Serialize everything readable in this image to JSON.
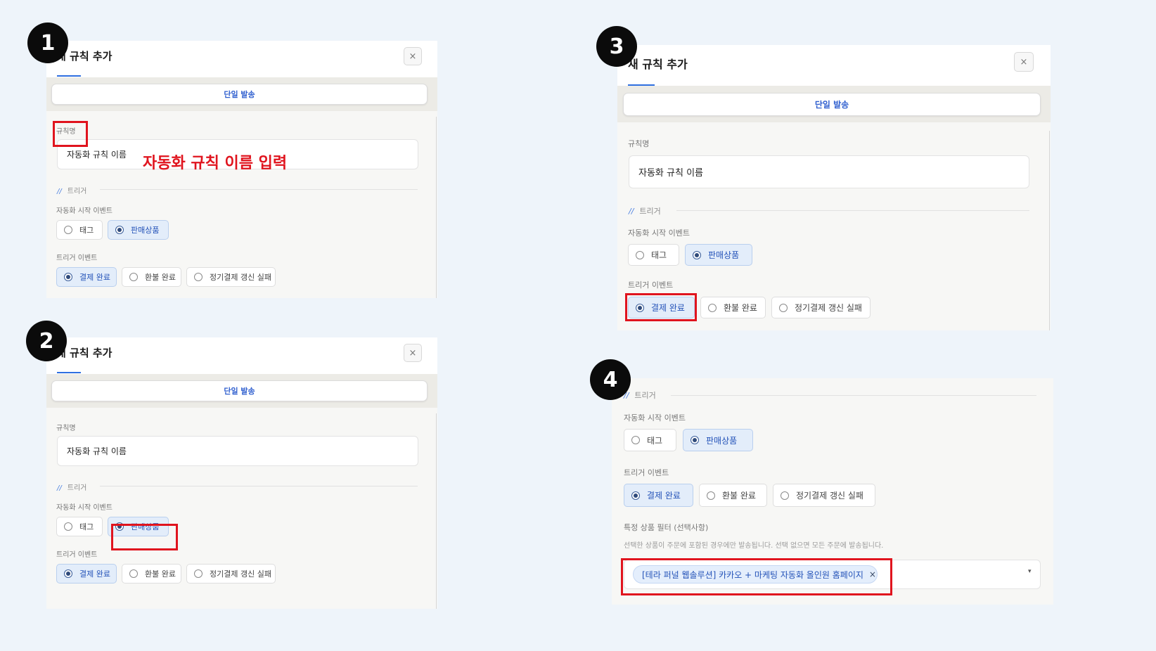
{
  "modal": {
    "title": "새 규칙 추가",
    "title_visible": "새 규칙 추가",
    "close_label": "×",
    "tab_single_send": "단일 발송"
  },
  "form": {
    "rule_name_label": "규칙명",
    "rule_name_value": "자동화 규칙 이름",
    "trigger_section": "트리거",
    "section_marker": "//",
    "start_event_label": "자동화 시작 이벤트",
    "start_event_options": [
      "태그",
      "판매상품"
    ],
    "start_event_selected": "판매상품",
    "trigger_event_label": "트리거 이벤트",
    "trigger_event_options": [
      "결제 완료",
      "환불 완료",
      "정기결제 갱신 실패"
    ],
    "trigger_event_selected": "결제 완료",
    "product_filter_label": "특정 상품 필터 (선택사항)",
    "product_filter_hint": "선택한 상품이 주문에 포함된 경우에만 발송됩니다. 선택 없으면 모든 주문에 발송됩니다.",
    "product_filter_chip": "[테라 퍼널 웹솔루션] 카카오 + 마케팅 자동화 올인원 홈페이지",
    "chip_remove": "×",
    "dropdown_arrow": "▾"
  },
  "annotations": {
    "step_1": "1",
    "step_2": "2",
    "step_3": "3",
    "step_4": "4",
    "step_1_note": "자동화 규칙 이름 입력"
  },
  "colors": {
    "accent": "#2f6fe0",
    "highlight_box": "#e0141e",
    "selected_option_bg": "#e3edfa",
    "page_bg": "#eef4fa"
  }
}
